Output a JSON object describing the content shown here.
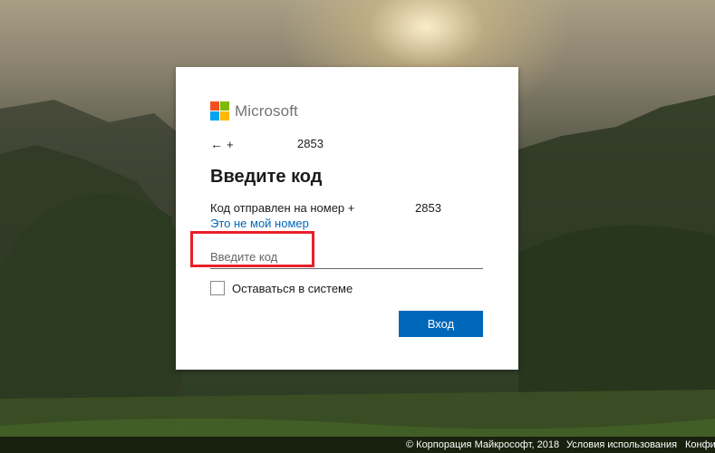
{
  "brand": {
    "name": "Microsoft",
    "logo_colors": [
      "#f25022",
      "#7fba00",
      "#00a4ef",
      "#ffb900"
    ]
  },
  "identity": {
    "back_icon": "arrow-left-icon",
    "back_glyph": "←",
    "prefix": "+",
    "number_suffix": "2853"
  },
  "title": "Введите код",
  "sent_message": {
    "text": "Код отправлен на номер +",
    "number_suffix": "2853"
  },
  "not_my_number_link": "Это не мой номер",
  "code_field": {
    "placeholder": "Введите код",
    "value": "",
    "highlight_color": "#e8202a"
  },
  "stay_signed_in": {
    "label": "Оставаться в системе",
    "checked": false
  },
  "submit_button": {
    "label": "Вход",
    "color": "#0067b8"
  },
  "footer": {
    "copyright": "© Корпорация Майкрософт, 2018",
    "terms": "Условия использования",
    "privacy": "Конфид"
  }
}
